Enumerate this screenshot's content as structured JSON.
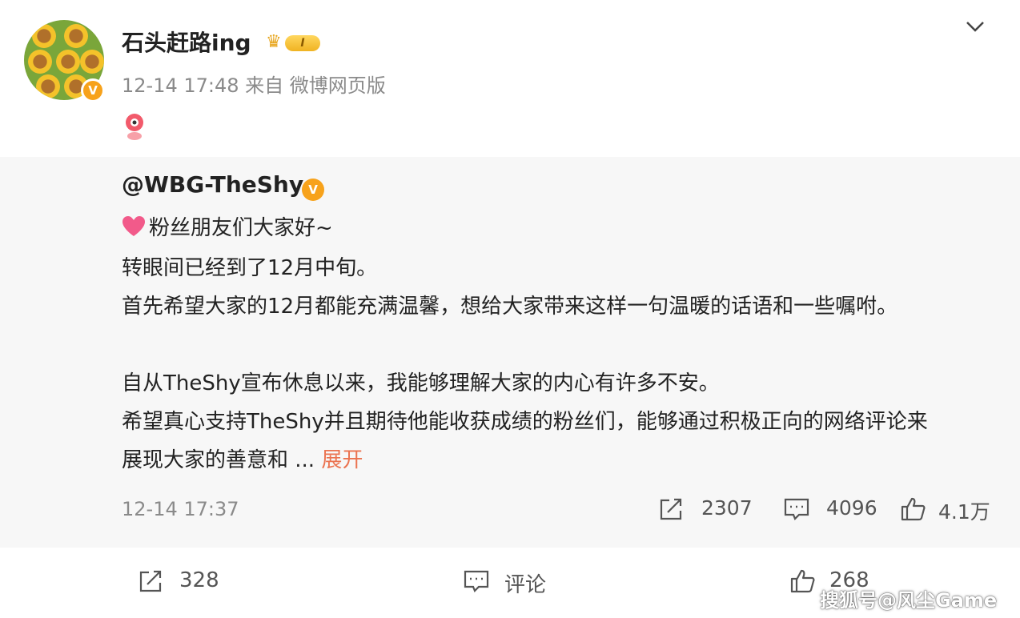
{
  "post": {
    "username": "石头赶路ing",
    "level_badge": "I",
    "meta": "12-14 17:48 来自 微博网页版",
    "verify_mark": "V"
  },
  "repost": {
    "author": "@WBG-TheShy",
    "verify_mark": "V",
    "lines": [
      "粉丝朋友们大家好~",
      "转眼间已经到了12月中旬。",
      "首先希望大家的12月都能充满温馨，想给大家带来这样一句温暖的话语和一些嘱咐。",
      "自从TheShy宣布休息以来，我能够理解大家的内心有许多不安。",
      "希望真心支持TheShy并且期待他能收获成绩的粉丝们，能够通过积极正向的网络评论来",
      "展现大家的善意和 "
    ],
    "ellipsis": "...",
    "expand_label": "展开",
    "time": "12-14 17:37",
    "repost_count": "2307",
    "comment_count": "4096",
    "like_count": "4.1万"
  },
  "actions": {
    "repost_count": "328",
    "comment_label": "评论",
    "like_count": "268"
  },
  "watermark": "搜狐号@风尘Game",
  "colors": {
    "accent": "#eb7350",
    "verify": "#f7a21b",
    "muted": "#8a8a8a",
    "repost_bg": "#f7f7f7"
  },
  "icons": {
    "chevron": "chevron-down-icon",
    "repost": "repost-icon",
    "comment": "comment-icon",
    "like": "thumbs-up-icon"
  }
}
